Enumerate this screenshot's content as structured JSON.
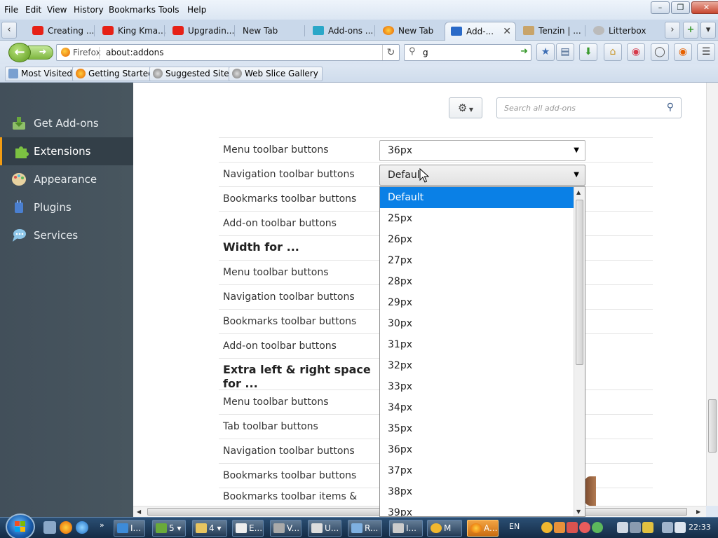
{
  "menubar": {
    "items": [
      "File",
      "Edit",
      "View",
      "History",
      "Bookmarks",
      "Tools",
      "Help"
    ]
  },
  "tabs": [
    {
      "label": "Creating ...",
      "icon": "youtube-icon",
      "color": "#e62117"
    },
    {
      "label": "King Kma...",
      "icon": "youtube-icon",
      "color": "#e62117"
    },
    {
      "label": "Upgradin...",
      "icon": "youtube-icon",
      "color": "#e62117"
    },
    {
      "label": "New Tab",
      "icon": "",
      "color": ""
    },
    {
      "label": "Add-ons ...",
      "icon": "puzzle-icon",
      "color": "#2aa7c8"
    },
    {
      "label": "New Tab",
      "icon": "firefox-icon",
      "color": "#e66000"
    },
    {
      "label": "Add-...",
      "icon": "puzzle-icon",
      "color": "#2a6ac8",
      "active": true
    },
    {
      "label": "Tenzin | ...",
      "icon": "arrow-icon",
      "color": "#c8a46a"
    },
    {
      "label": "Litterbox",
      "icon": "page-icon",
      "color": "#bbbbbb"
    }
  ],
  "navbar": {
    "identity_label": "Firefox",
    "url": "about:addons",
    "search_value": "g"
  },
  "bookmarks": [
    "Most Visited",
    "Getting Started",
    "Suggested Sites",
    "Web Slice Gallery"
  ],
  "sidebar": {
    "items": [
      {
        "label": "Get Add-ons",
        "icon": "get-addons-icon"
      },
      {
        "label": "Extensions",
        "icon": "extensions-icon",
        "selected": true
      },
      {
        "label": "Appearance",
        "icon": "appearance-icon"
      },
      {
        "label": "Plugins",
        "icon": "plugins-icon"
      },
      {
        "label": "Services",
        "icon": "services-icon"
      }
    ]
  },
  "addon_search": {
    "placeholder": "Search all add-ons"
  },
  "prefs": {
    "rows": [
      {
        "label": "Menu toolbar buttons",
        "type": "row"
      },
      {
        "label": "Navigation toolbar buttons",
        "type": "row"
      },
      {
        "label": "Bookmarks toolbar buttons",
        "type": "row"
      },
      {
        "label": "Add-on toolbar buttons",
        "type": "row"
      },
      {
        "label": "Width for ...",
        "type": "header"
      },
      {
        "label": "Menu toolbar buttons",
        "type": "row"
      },
      {
        "label": "Navigation toolbar buttons",
        "type": "row"
      },
      {
        "label": "Bookmarks toolbar buttons",
        "type": "row"
      },
      {
        "label": "Add-on toolbar buttons",
        "type": "row"
      },
      {
        "label": "Extra left & right space for ...",
        "type": "header"
      },
      {
        "label": "Menu toolbar buttons",
        "type": "row"
      },
      {
        "label": "Tab toolbar buttons",
        "type": "row"
      },
      {
        "label": "Navigation toolbar buttons",
        "type": "row"
      },
      {
        "label": "Bookmarks toolbar buttons",
        "type": "row"
      },
      {
        "label": "Bookmarks toolbar items &",
        "type": "row"
      }
    ],
    "select_menu_value": "36px",
    "select_nav_value": "Default"
  },
  "dropdown": {
    "options": [
      "Default",
      "25px",
      "26px",
      "27px",
      "28px",
      "29px",
      "30px",
      "31px",
      "32px",
      "33px",
      "34px",
      "35px",
      "36px",
      "37px",
      "38px",
      "39px"
    ],
    "highlighted": "Default"
  },
  "taskbar": {
    "tasks": [
      {
        "label": "I...",
        "icon": "ie-icon"
      },
      {
        "label": "5",
        "icon": "group-icon"
      },
      {
        "label": "4",
        "icon": "folder-icon"
      },
      {
        "label": "E...",
        "icon": "app-icon"
      },
      {
        "label": "V...",
        "icon": "audio-icon"
      },
      {
        "label": "U...",
        "icon": "window-icon"
      },
      {
        "label": "R...",
        "icon": "network-icon"
      },
      {
        "label": "I...",
        "icon": "presentation-icon"
      },
      {
        "label": "M",
        "icon": "m-icon"
      },
      {
        "label": "A...",
        "icon": "firefox-icon",
        "active": true
      }
    ],
    "language": "EN",
    "clock": "22:33"
  },
  "colors": {
    "sidebar_bg": "#48565f",
    "sidebar_accent": "#f39c12",
    "highlight": "#0a80e6",
    "taskbar_bg": "#1e3a5c"
  }
}
